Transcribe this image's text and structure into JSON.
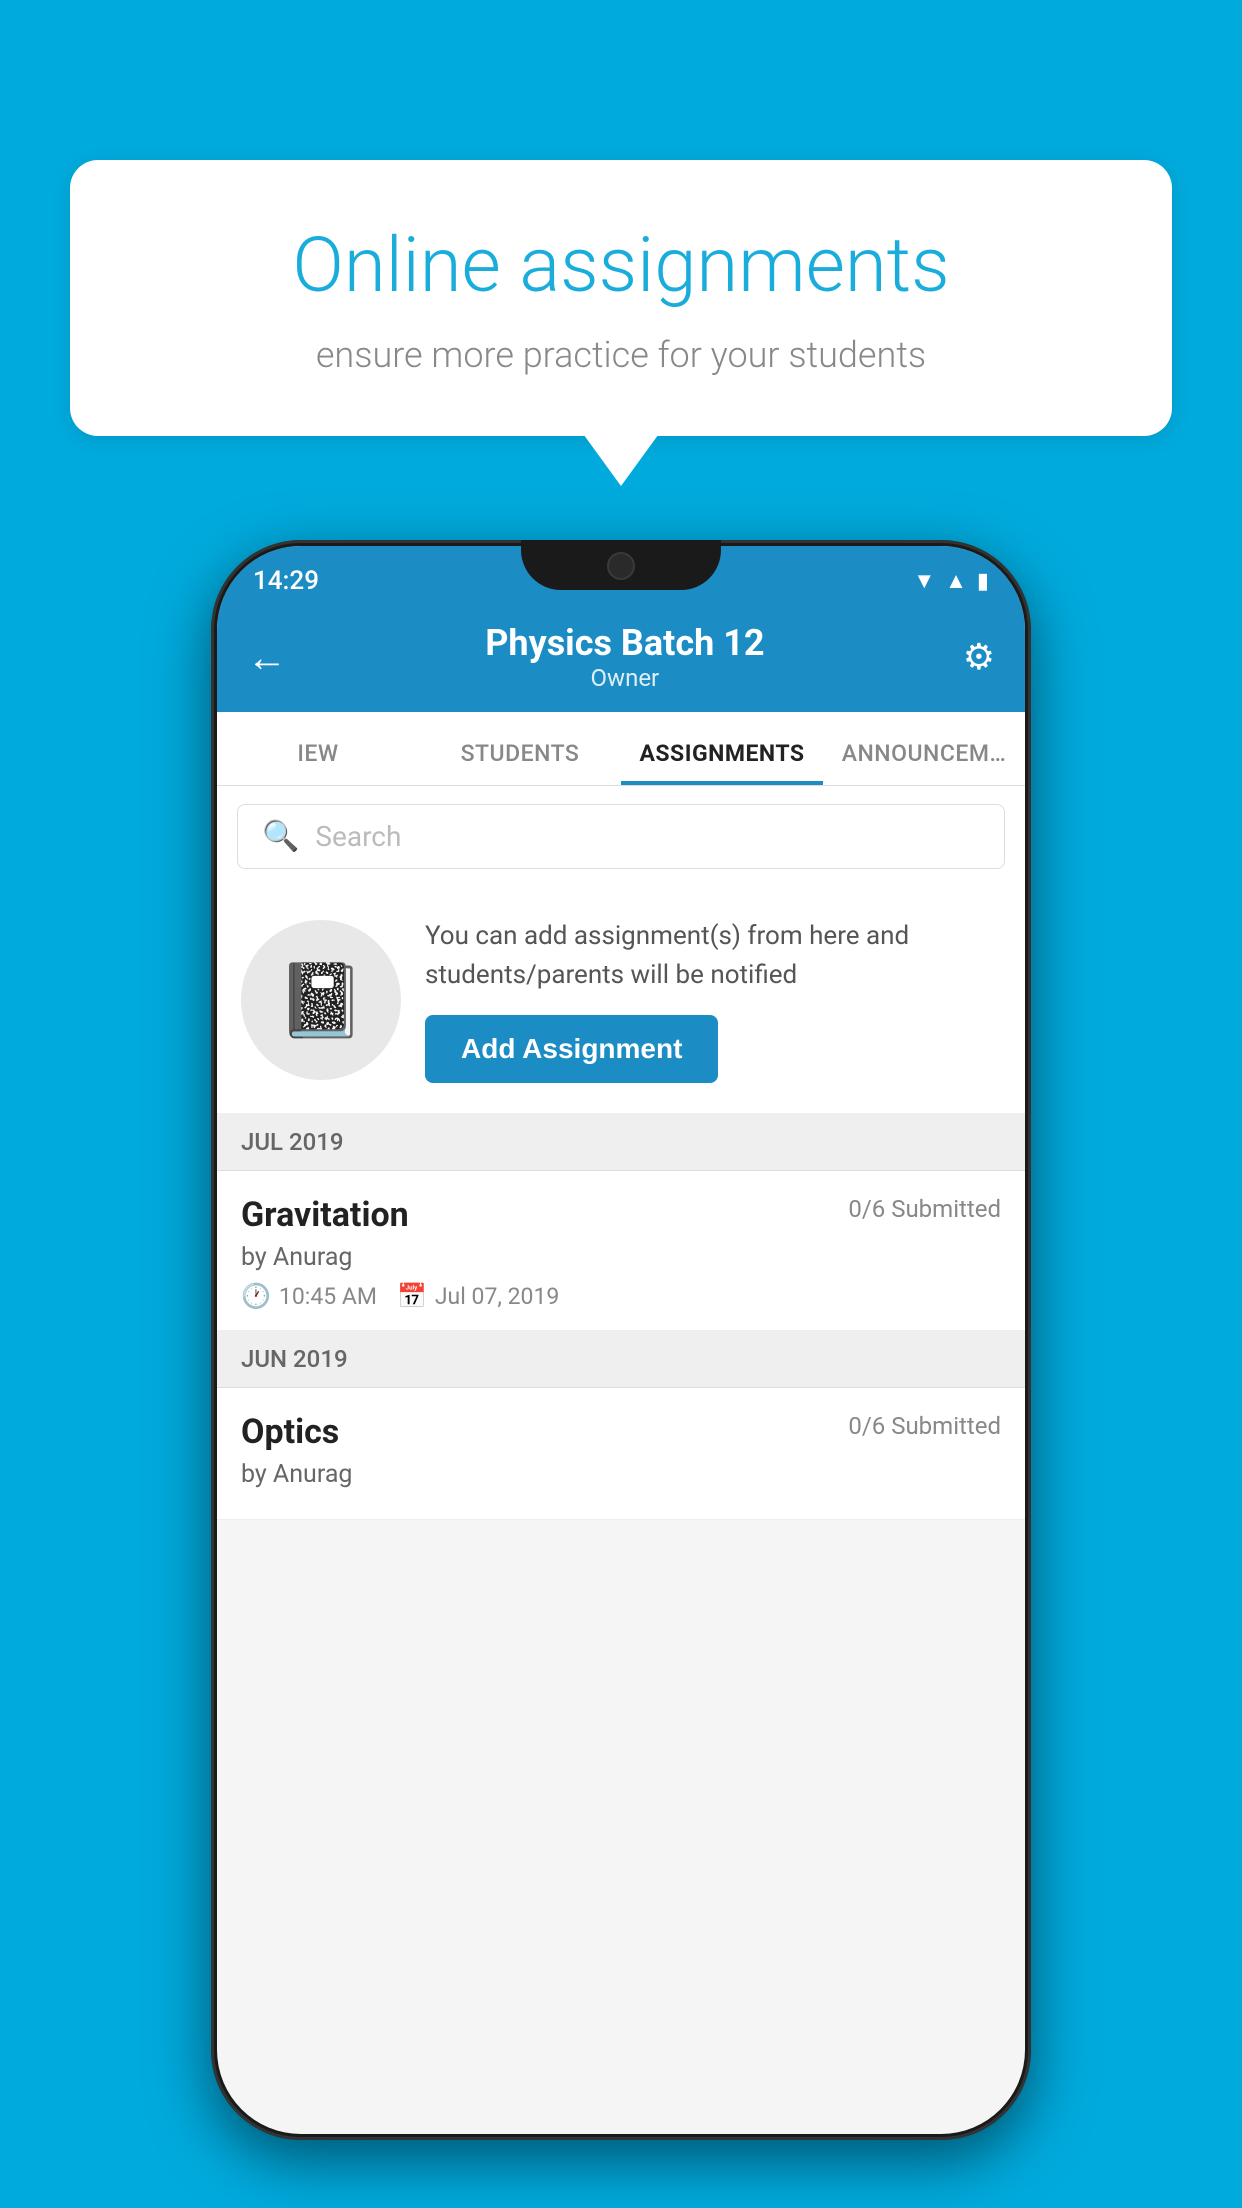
{
  "page": {
    "background_color": "#00AADD"
  },
  "speech_bubble": {
    "title": "Online assignments",
    "subtitle": "ensure more practice for your students"
  },
  "phone": {
    "status_bar": {
      "time": "14:29",
      "wifi": "▼",
      "signal": "▲",
      "battery": "▮"
    },
    "header": {
      "title": "Physics Batch 12",
      "subtitle": "Owner",
      "back_label": "←",
      "gear_label": "⚙"
    },
    "tabs": [
      {
        "label": "IEW",
        "active": false
      },
      {
        "label": "STUDENTS",
        "active": false
      },
      {
        "label": "ASSIGNMENTS",
        "active": true
      },
      {
        "label": "ANNOUNCEMENTS",
        "active": false
      }
    ],
    "search": {
      "placeholder": "Search"
    },
    "promo": {
      "description": "You can add assignment(s) from here and students/parents will be notified",
      "button_label": "Add Assignment"
    },
    "sections": [
      {
        "label": "JUL 2019",
        "assignments": [
          {
            "name": "Gravitation",
            "submitted": "0/6 Submitted",
            "by": "by Anurag",
            "time": "10:45 AM",
            "date": "Jul 07, 2019"
          }
        ]
      },
      {
        "label": "JUN 2019",
        "assignments": [
          {
            "name": "Optics",
            "submitted": "0/6 Submitted",
            "by": "by Anurag",
            "time": "",
            "date": ""
          }
        ]
      }
    ]
  }
}
